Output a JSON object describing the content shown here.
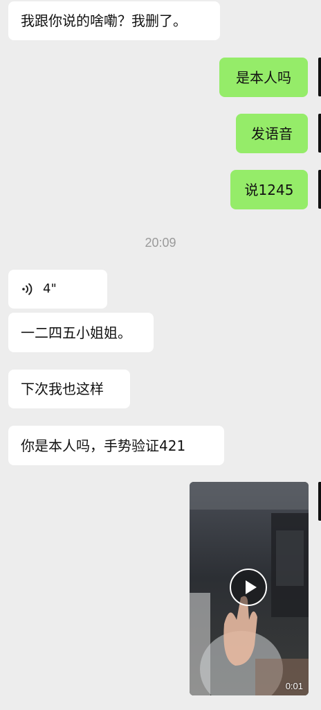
{
  "messages": [
    {
      "side": "in",
      "text": "我跟你说的啥嘞？我删了。"
    },
    {
      "side": "out",
      "text": "是本人吗"
    },
    {
      "side": "out",
      "text": "发语音"
    },
    {
      "side": "out",
      "text": "说1245"
    },
    {
      "side": "in",
      "type": "voice",
      "duration": "4\""
    },
    {
      "side": "in",
      "text": "一二四五小姐姐。"
    },
    {
      "side": "in",
      "text": "下次我也这样"
    },
    {
      "side": "in",
      "text": "你是本人吗，手势验证421"
    },
    {
      "side": "out",
      "type": "video",
      "duration": "0:01"
    }
  ],
  "timestamp": "20:09",
  "icons": {
    "voice": "voice-wave-icon",
    "play": "play-icon"
  },
  "colors": {
    "background": "#ededed",
    "incoming_bubble": "#ffffff",
    "outgoing_bubble": "#95ec69",
    "timestamp": "#9a9a9a"
  }
}
